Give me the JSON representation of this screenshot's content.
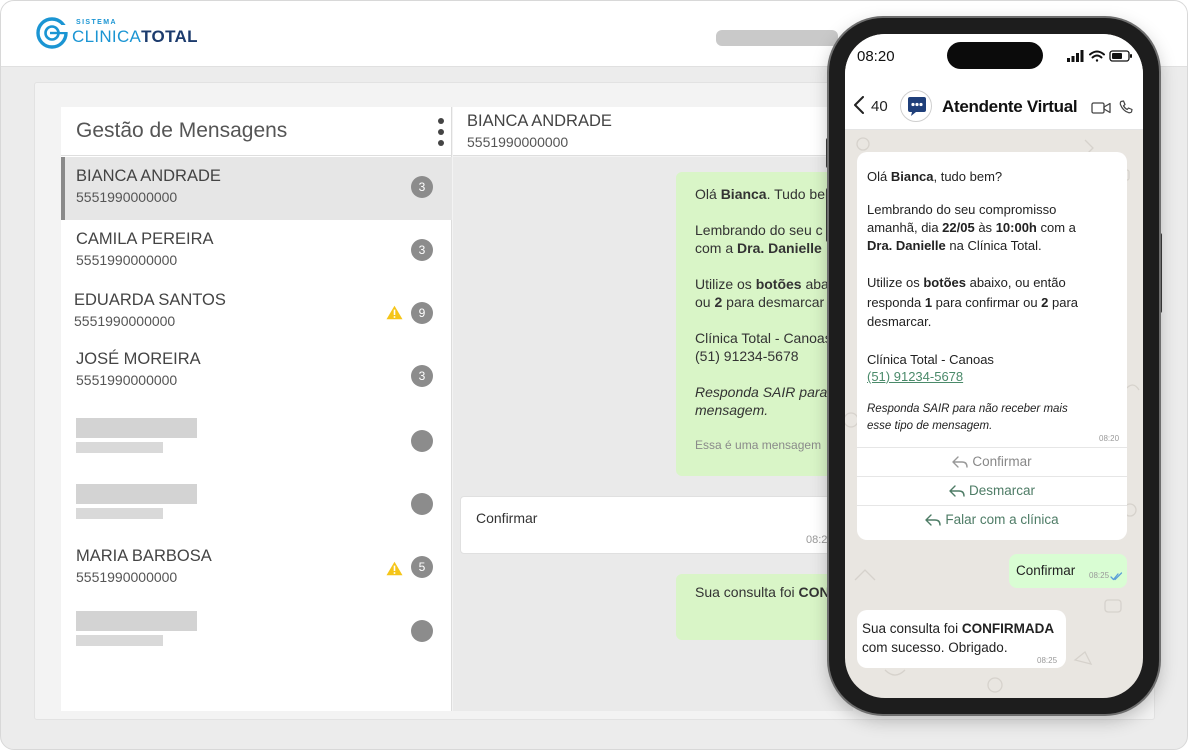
{
  "app": {
    "logo_small": "SISTEMA",
    "logo_prefix": "CLINICA",
    "logo_suffix": "TOTAL"
  },
  "list": {
    "title": "Gestão de Mensagens",
    "items": [
      {
        "name": "BIANCA ANDRADE",
        "phone": "5551990000000",
        "count": "3"
      },
      {
        "name": "CAMILA PEREIRA",
        "phone": "5551990000000",
        "count": "3"
      },
      {
        "name": "EDUARDA SANTOS",
        "phone": "5551990000000",
        "count": "9"
      },
      {
        "name": "JOSÉ MOREIRA",
        "phone": "5551990000000",
        "count": "3"
      },
      {
        "name": "MARIA BARBOSA",
        "phone": "5551990000000",
        "count": "5"
      }
    ]
  },
  "chat": {
    "name": "BIANCA ANDRADE",
    "phone": "5551990000000",
    "msg1": {
      "l1_pre": "Olá ",
      "l1_bold": "Bianca",
      "l1_post": ". Tudo bem",
      "l2": "Lembrando do seu c",
      "l3_pre": "com a ",
      "l3_bold": "Dra. Danielle",
      "l4_pre": "Utilize os ",
      "l4_bold": "botões",
      "l4_post": " aba",
      "l5_pre": "ou ",
      "l5_bold": "2",
      "l5_post": " para desmarcar",
      "l6": "Clínica Total - Canoas",
      "l7": "(51) 91234-5678",
      "l8": "Responda SAIR para",
      "l9": "mensagem.",
      "l10": "Essa é uma mensagem"
    },
    "reply": {
      "text": "Confirmar",
      "time": "08:2"
    },
    "msg3": {
      "pre": "Sua consulta foi ",
      "bold": "CON"
    }
  },
  "phone": {
    "time": "08:20",
    "back_count": "40",
    "agent": "Atendente Virtual",
    "msg": {
      "greet_pre": "Olá ",
      "greet_bold": "Bianca",
      "greet_post": ", tudo bem?",
      "p2_l1": "Lembrando do seu compromisso",
      "p2_l2_pre": "amanhã, dia ",
      "p2_l2_date": "22/05",
      "p2_l2_mid": " às ",
      "p2_l2_hour": "10:00h",
      "p2_l2_post": " com a",
      "p2_l3_bold": "Dra. Danielle",
      "p2_l3_post": " na Clínica Total.",
      "p3_l1_pre": "Utilize os ",
      "p3_l1_bold": "botões",
      "p3_l1_post": " abaixo, ou então",
      "p3_l2_pre": "responda ",
      "p3_l2_b1": "1",
      "p3_l2_mid": " para confirmar ou ",
      "p3_l2_b2": "2",
      "p3_l2_post": " para",
      "p3_l3": "desmarcar.",
      "p4_l1": "Clínica Total - Canoas",
      "p4_l2": "(51) 91234-5678",
      "p5_l1": "Responda SAIR para não receber mais",
      "p5_l2": "esse tipo de mensagem.",
      "time": "08:20"
    },
    "buttons": [
      "Confirmar",
      "Desmarcar",
      "Falar com a clínica"
    ],
    "sent": {
      "text": "Confirmar",
      "time": "08:25"
    },
    "recv": {
      "l1_pre": "Sua consulta foi ",
      "l1_bold": "CONFIRMADA",
      "l2": "com sucesso. Obrigado.",
      "time": "08:25"
    }
  },
  "colors": {
    "brand": "#1b95d3",
    "brand_dark": "#1c3b6d",
    "bubble_green": "#d9f5c7",
    "whatsapp_sent": "#d9fdd3",
    "badge": "#8c8c8c",
    "warning": "#f5c518"
  },
  "icons": [
    "clinica-logo-icon",
    "kebab-menu-icon",
    "warning-icon",
    "back-chevron-icon",
    "chatbot-avatar-icon",
    "video-call-icon",
    "phone-call-icon",
    "reply-icon",
    "double-check-icon",
    "signal-icon",
    "wifi-icon",
    "battery-icon"
  ]
}
